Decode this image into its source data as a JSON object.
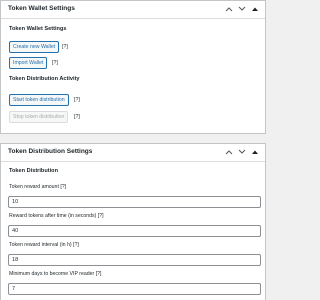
{
  "wallet_box": {
    "title": "Token Wallet Settings",
    "section_wallet": "Token Wallet Settings",
    "create_wallet": "Create new Wallet",
    "import_wallet": "Import Wallet",
    "section_distribution_activity": "Token Distribution Activity",
    "start_distribution": "Start token distribution",
    "stop_distribution": "Stop token distribution",
    "help": "[?]"
  },
  "distribution_box": {
    "title": "Token Distribution Settings",
    "section": "Token Distribution",
    "help": "[?]",
    "fields": [
      {
        "label": "Token reward amount [?]",
        "value": "10"
      },
      {
        "label": "Reward tokens after time (in seconds) [?]",
        "value": "40"
      },
      {
        "label": "Token reward interval (in h) [?]",
        "value": "18"
      },
      {
        "label": "Minimum days to become VIP reader [?]",
        "value": "7"
      }
    ]
  },
  "icons": {
    "collapse_up": "chevron-up-icon",
    "collapse_down": "chevron-down-icon",
    "toggle": "triangle-up-icon"
  },
  "colors": {
    "accent": "#2271b1",
    "border": "#c3c4c7",
    "background": "#f0f0f1"
  }
}
